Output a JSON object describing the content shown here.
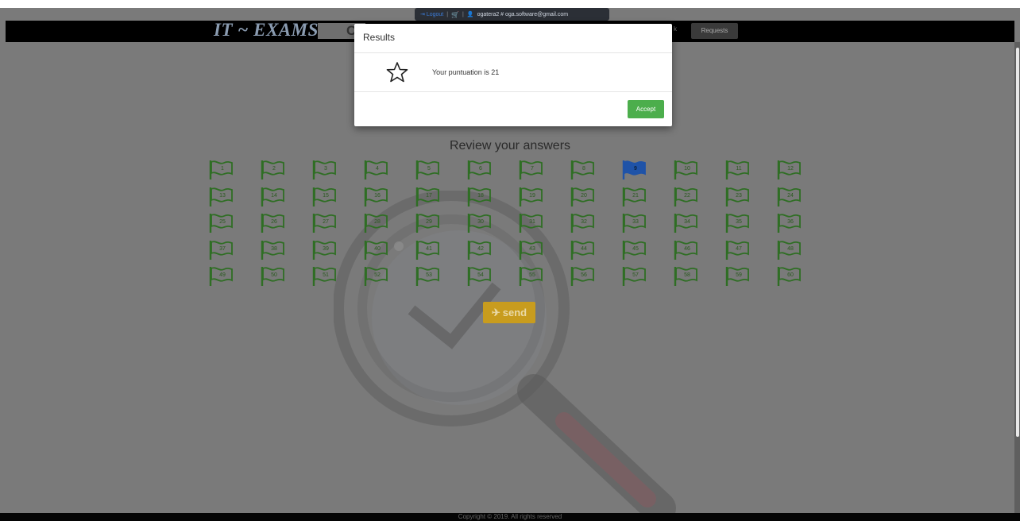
{
  "userbar": {
    "logout_label": "Logout",
    "separator": "|",
    "user": "ogatera2 # oga.software@gmail.com"
  },
  "navbar": {
    "logo": "IT ~ EXAMS",
    "search_partial": "C",
    "nav_partial": "k",
    "requests_label": "Requests"
  },
  "modal": {
    "title": "Results",
    "message": "Your puntuation is 21",
    "accept_label": "Accept",
    "icon": "star-icon"
  },
  "review": {
    "title": "Review your answers",
    "question_count": 60,
    "current_question": 9,
    "columns": 12,
    "flag_color": "#2f6e24",
    "current_flag_color": "#1f53a8"
  },
  "send": {
    "label": "send",
    "icon": "paper-plane-icon"
  },
  "footer": {
    "text": "Copyright © 2019. All rights reserved"
  },
  "colors": {
    "overlay": "#7a7a7a",
    "accent_green": "#4cae4c",
    "send_button": "#c89c1e"
  }
}
